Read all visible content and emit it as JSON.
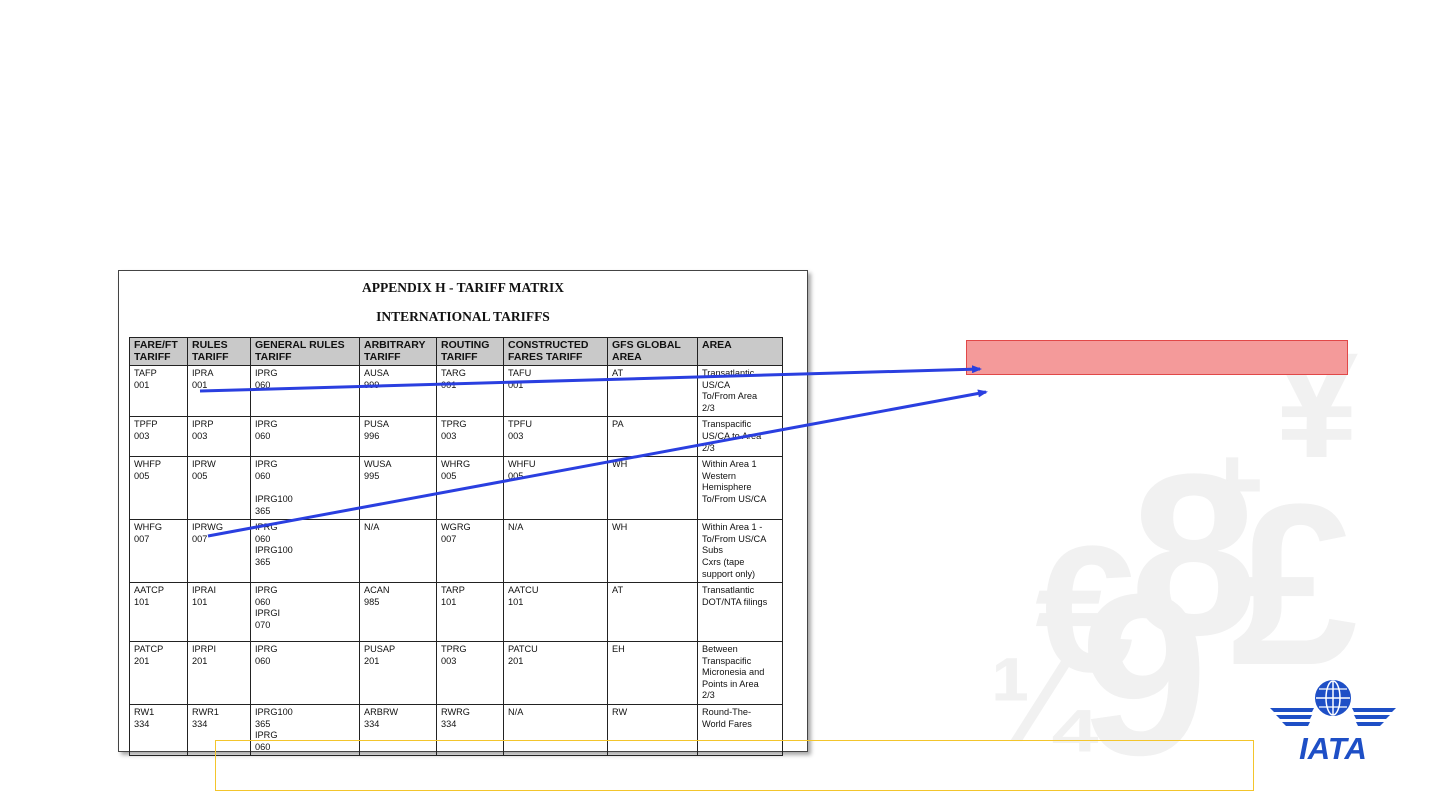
{
  "document": {
    "title": "APPENDIX H - TARIFF MATRIX",
    "subtitle": "INTERNATIONAL TARIFFS",
    "columns": [
      "FARE/FT\nTARIFF",
      "RULES\nTARIFF",
      "GENERAL RULES\nTARIFF",
      "ARBITRARY\nTARIFF",
      "ROUTING\nTARIFF",
      "CONSTRUCTED\nFARES TARIFF",
      "GFS GLOBAL\nAREA",
      "AREA"
    ],
    "rows": [
      [
        "TAFP\n001",
        "IPRA\n001",
        "IPRG\n060",
        "AUSA\n999",
        "TARG\n001",
        "TAFU\n001",
        "AT",
        "Transatlantic\nUS/CA\nTo/From Area\n2/3"
      ],
      [
        "TPFP\n003",
        "IPRP\n003",
        "IPRG\n060",
        "PUSA\n996",
        "TPRG\n003",
        "TPFU\n003",
        "PA",
        "Transpacific\nUS/CA to Area\n2/3"
      ],
      [
        "WHFP\n005",
        "IPRW\n005",
        "IPRG\n060\n\nIPRG100\n365",
        "WUSA\n995",
        "WHRG\n005",
        "WHFU\n005",
        "WH",
        "Within Area 1\nWestern\nHemisphere\nTo/From US/CA"
      ],
      [
        "WHFG\n007",
        "IPRWG\n007",
        "IPRG\n060\nIPRG100\n365",
        "N/A",
        "WGRG\n007",
        "N/A",
        "WH",
        "Within Area 1 -\nTo/From US/CA\nSubs\nCxrs (tape\nsupport only)"
      ],
      [
        "AATCP\n101",
        "IPRAI\n101",
        "IPRG\n060\nIPRGI\n070",
        "ACAN\n985",
        "TARP\n101",
        "AATCU\n101",
        "AT",
        "Transatlantic\nDOT/NTA filings"
      ],
      [
        "PATCP\n201",
        "IPRPI\n201",
        "IPRG\n060",
        "PUSAP\n201",
        "TPRG\n003",
        "PATCU\n201",
        "EH",
        "Between\nTranspacific\nMicronesia and\nPoints in Area\n2/3"
      ],
      [
        "RW1\n334",
        "RWR1\n334",
        "IPRG100\n365\nIPRG\n060",
        "ARBRW\n334",
        "RWRG\n334",
        "N/A",
        "RW",
        "Round-The-\nWorld Fares"
      ]
    ]
  },
  "callout_box": {
    "text": ""
  },
  "bottom_box": {
    "text": ""
  },
  "watermark": {
    "symbols": [
      "¥",
      "+",
      "8",
      "£",
      "€",
      "9",
      "¼"
    ]
  },
  "logo": {
    "text": "IATA",
    "color": "#1e4fc6"
  },
  "colors": {
    "arrow": "#2a3fe0",
    "callout_fill": "#f49a9a",
    "callout_border": "#e14848",
    "bottom_border": "#f3c52c",
    "header_fill": "#c9c9c9"
  }
}
